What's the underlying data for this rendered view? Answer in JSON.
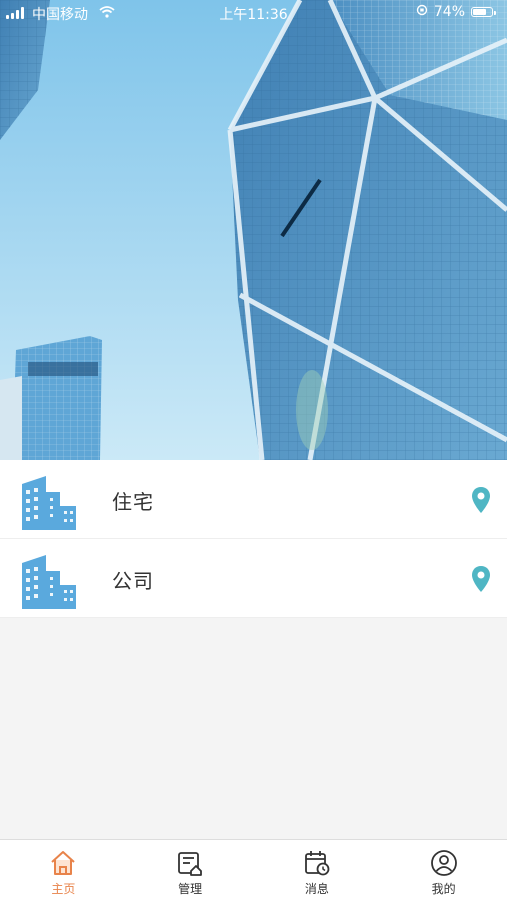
{
  "status_bar": {
    "carrier": "中国移动",
    "time": "上午11:36",
    "battery": "74%",
    "battery_level": 0.74
  },
  "colors": {
    "accent": "#e8834a",
    "pin": "#4fb6c4",
    "building": "#5aa9dd",
    "sky": "#9fd3ee"
  },
  "list": {
    "items": [
      {
        "label": "住宅",
        "icon": "building-icon",
        "action_icon": "location-pin-icon"
      },
      {
        "label": "公司",
        "icon": "building-icon",
        "action_icon": "location-pin-icon"
      }
    ]
  },
  "tabbar": {
    "tabs": [
      {
        "label": "主页",
        "icon": "home-icon",
        "active": true
      },
      {
        "label": "管理",
        "icon": "manage-icon",
        "active": false
      },
      {
        "label": "消息",
        "icon": "calendar-clock-icon",
        "active": false
      },
      {
        "label": "我的",
        "icon": "profile-icon",
        "active": false
      }
    ]
  }
}
